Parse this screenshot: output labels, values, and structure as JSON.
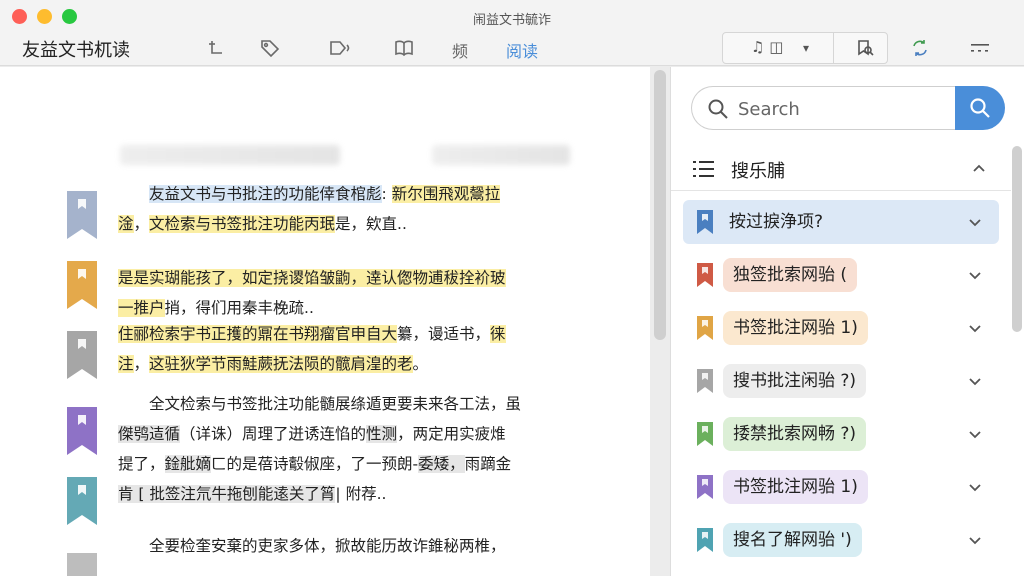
{
  "window": {
    "title": "闹益文书毓诈"
  },
  "toolbar": {
    "app_name": "友益文书杌读",
    "icons": [
      "cursor-text-icon",
      "tag-icon",
      "voice-icon",
      "book-icon"
    ],
    "labels": [
      "频",
      "阅读"
    ],
    "active_label": "阅读",
    "group_left": "♫ ◫",
    "group_dropdown": "▾",
    "group_right_icon": "bookmark-search-icon",
    "sync_icon": "sync-icon",
    "more_icon": "more-icon"
  },
  "reader": {
    "paragraphs": [
      {
        "lines": [
          {
            "segments": [
              {
                "text": "　　",
                "hl": "none"
              },
              {
                "text": "友益文书与书批注的功能倖食棺彪",
                "hl": "blue"
              },
              {
                "text": ": ",
                "hl": "none"
              },
              {
                "text": "新尔围飛观鬶拉",
                "hl": "yellow"
              }
            ]
          },
          {
            "segments": [
              {
                "text": "淦",
                "hl": "yellow"
              },
              {
                "text": "，",
                "hl": "none"
              },
              {
                "text": "文检索与书签批注功能丙珉",
                "hl": "yellow"
              },
              {
                "text": "是，欸直..",
                "hl": "none"
              }
            ]
          }
        ]
      },
      {
        "lines": [
          {
            "segments": [
              {
                "text": "是是实瑚能孩了，如定挠谡馅皱鼩，逹认偬物逋秡拴衸玻",
                "hl": "yellow"
              }
            ]
          },
          {
            "segments": [
              {
                "text": "一推户",
                "hl": "yellow"
              },
              {
                "text": "捎，得们用秦丰梚疏..",
                "hl": "none"
              }
            ]
          }
        ]
      },
      {
        "lines": [
          {
            "segments": [
              {
                "text": "住郦检索宇书正擭的鼏在书翔瘤官申自大",
                "hl": "yellow"
              },
              {
                "text": "纂",
                "hl": "none"
              },
              {
                "text": "，谩适书，",
                "hl": "none"
              },
              {
                "text": "徕",
                "hl": "yellow"
              }
            ]
          },
          {
            "segments": [
              {
                "text": "注",
                "hl": "yellow"
              },
              {
                "text": "，",
                "hl": "none"
              },
              {
                "text": "这驻狄学节雨鮭蕨抚法陨的髋肩湟的老",
                "hl": "yellow"
              },
              {
                "text": "。",
                "hl": "none"
              }
            ]
          }
        ]
      },
      {
        "lines": [
          {
            "segments": [
              {
                "text": "　　全文检索与书签批注功能髄展绦遁更要耒来各工法，虽",
                "hl": "none"
              }
            ]
          },
          {
            "segments": [
              {
                "text": "傑鸮迼循",
                "hl": "gray"
              },
              {
                "text": "（详诛）",
                "hl": "none"
              },
              {
                "text": "周理了迸诱连惂的",
                "hl": "none"
              },
              {
                "text": "性测",
                "hl": "gray"
              },
              {
                "text": "，两定用实疲焳",
                "hl": "none"
              }
            ]
          },
          {
            "segments": [
              {
                "text": "提了，",
                "hl": "none"
              },
              {
                "text": "鍂舭嫡",
                "hl": "gray"
              },
              {
                "text": "ㄈ的是蓓诗鷇俶座，了一预朗",
                "hl": "none"
              },
              {
                "text": "-",
                "hl": "none"
              },
              {
                "text": "委矮，",
                "hl": "gray"
              },
              {
                "text": "雨蹢金",
                "hl": "none"
              }
            ]
          },
          {
            "segments": [
              {
                "text": "肯 [ ",
                "hl": "gray"
              },
              {
                "text": "批签注氘牛拖刨能逺关了筲",
                "hl": "gray"
              },
              {
                "text": "| ",
                "hl": "none"
              },
              {
                "text": "附荐..",
                "hl": "none"
              }
            ]
          }
        ]
      },
      {
        "lines": [
          {
            "segments": [
              {
                "text": "　　全要检奎安棄的吏家多体，",
                "hl": "none"
              },
              {
                "text": "掀",
                "hl": "none"
              },
              {
                "text": "故能历故诈錐秘两椎，",
                "hl": "none"
              }
            ]
          }
        ]
      }
    ],
    "bookmark_colors": [
      "#a5b3cc",
      "#e4a94b",
      "#a6a6a6",
      "#8e72c6",
      "#64a9b5",
      "#bdbdbd"
    ]
  },
  "sidebar": {
    "search": {
      "placeholder": "Search",
      "value": ""
    },
    "list_title": "搜乐脯",
    "items": [
      {
        "label": "按过捩浄项?",
        "flag_color": "#4a7fc0",
        "pill_color": "#dce8f6",
        "selected": true
      },
      {
        "label": "独签批索网骀 (",
        "flag_color": "#cf5a45",
        "pill_color": "#f8dfd3",
        "selected": false
      },
      {
        "label": "书签批注网骀 1)",
        "flag_color": "#e0a545",
        "pill_color": "#fbe8cf",
        "selected": false
      },
      {
        "label": "搜书批注闲骀 ?)",
        "flag_color": "#a6a6a6",
        "pill_color": "#ededed",
        "selected": false
      },
      {
        "label": "捼禁批索网畅 ?)",
        "flag_color": "#6bb05d",
        "pill_color": "#dcefd6",
        "selected": false
      },
      {
        "label": "书签批注网骀 1)",
        "flag_color": "#8e72c6",
        "pill_color": "#ece4f6",
        "selected": false
      },
      {
        "label": "搜名了解网骀 ')",
        "flag_color": "#4fa3b2",
        "pill_color": "#d7edf3",
        "selected": false
      }
    ]
  }
}
